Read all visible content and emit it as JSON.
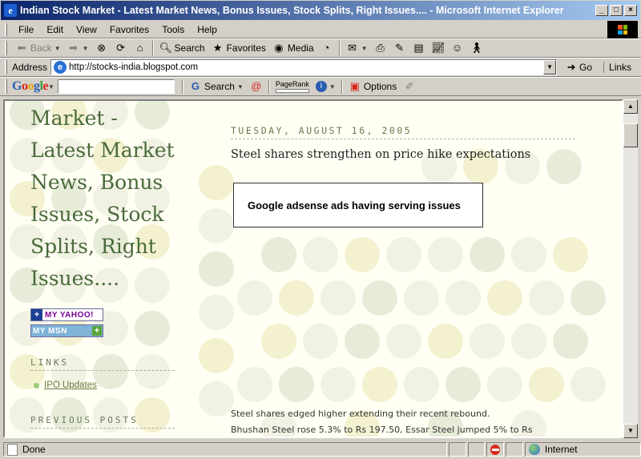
{
  "window": {
    "title": "Indian Stock Market - Latest Market News, Bonus Issues, Stock Splits, Right Issues.... - Microsoft Internet Explorer"
  },
  "menu": [
    "File",
    "Edit",
    "View",
    "Favorites",
    "Tools",
    "Help"
  ],
  "toolbar": {
    "back": "Back",
    "search": "Search",
    "favorites": "Favorites",
    "media": "Media"
  },
  "address": {
    "label": "Address",
    "url": "http://stocks-india.blogspot.com",
    "go": "Go",
    "links": "Links"
  },
  "googlebar": {
    "search": "Search",
    "pagerank": "PageRank",
    "options": "Options"
  },
  "sidebar": {
    "title": "Market - Latest Market News, Bonus Issues, Stock Splits, Right Issues....",
    "yahoo_badge": "MY YAHOO!",
    "msn_badge": "MY MSN",
    "links_heading": "LINKS",
    "links": [
      "IPO Updates"
    ],
    "previous_heading": "PREVIOUS POSTS"
  },
  "post": {
    "date": "TUESDAY, AUGUST 16, 2005",
    "title": "Steel shares strengthen on price hike expectations",
    "ad_text": "Google adsense ads having serving issues",
    "body": [
      "Steel shares edged higher extending their recent rebound.",
      "Bhushan Steel rose 5.3% to Rs 197.50, Essar Steel jumped 5% to Rs"
    ]
  },
  "status": {
    "text": "Done",
    "zone": "Internet"
  },
  "colors": {
    "title_green": "#4a6a3a",
    "titlebar_start": "#0a246a",
    "titlebar_end": "#a6caf0"
  }
}
